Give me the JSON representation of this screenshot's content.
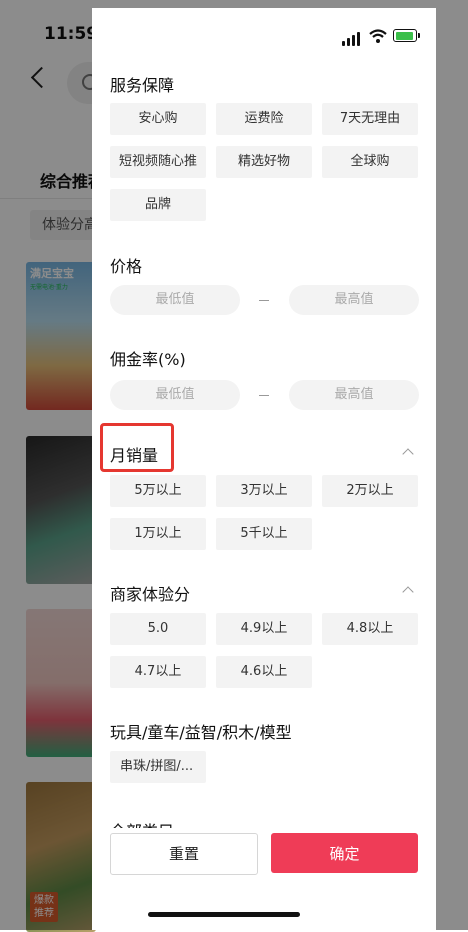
{
  "status_bar": {
    "time": "11:59"
  },
  "background_page": {
    "tab_label": "综合推荐",
    "filter_chip": "体验分高",
    "items": [
      {
        "caption": "满足宝宝",
        "subcaption": "无需电池·重力"
      },
      {},
      {},
      {
        "tag": "爆款推荐"
      }
    ]
  },
  "filter_panel": {
    "sections": {
      "service": {
        "title": "服务保障",
        "options": [
          "安心购",
          "运费险",
          "7天无理由",
          "短视频随心推",
          "精选好物",
          "全球购",
          "品牌"
        ]
      },
      "price": {
        "title": "价格",
        "min_placeholder": "最低值",
        "max_placeholder": "最高值"
      },
      "commission": {
        "title": "佣金率(%)",
        "min_placeholder": "最低值",
        "max_placeholder": "最高值"
      },
      "monthly_sales": {
        "title": "月销量",
        "options": [
          "5万以上",
          "3万以上",
          "2万以上",
          "1万以上",
          "5千以上"
        ]
      },
      "merchant_score": {
        "title": "商家体验分",
        "options": [
          "5.0",
          "4.9以上",
          "4.8以上",
          "4.7以上",
          "4.6以上"
        ]
      },
      "category": {
        "title": "玩具/童车/益智/积木/模型",
        "options": [
          "串珠/拼图/..."
        ]
      },
      "all_categories": {
        "title": "全部类目"
      }
    },
    "footer": {
      "reset_label": "重置",
      "confirm_label": "确定"
    },
    "colors": {
      "confirm": "#ef3c57",
      "highlight": "#e53730",
      "chip_bg": "#f3f3f3"
    }
  }
}
